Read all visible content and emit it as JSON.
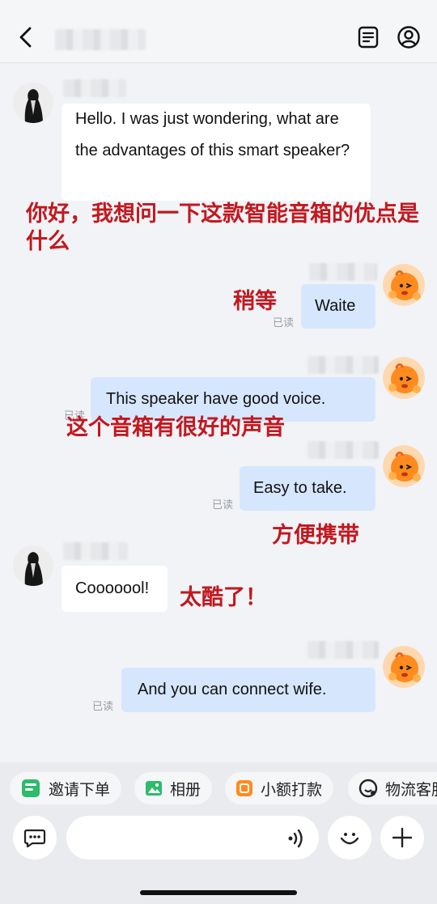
{
  "header": {
    "back_icon": "chevron-left-icon",
    "contact_name": "",
    "icons": [
      "notes-icon",
      "user-profile-icon"
    ]
  },
  "messages": [
    {
      "side": "in",
      "text": "Hello. I was just wondering, what are the advantages of this smart speaker?"
    },
    {
      "side": "out",
      "text": "Waite",
      "status": "已读"
    },
    {
      "side": "out",
      "text": "This speaker have good voice.",
      "status": "已读"
    },
    {
      "side": "out",
      "text": "Easy to take.",
      "status": "已读"
    },
    {
      "side": "in",
      "text": "Cooooool!"
    },
    {
      "side": "out",
      "text": "And you can connect wife.",
      "status": "已读"
    }
  ],
  "annotations": [
    "你好，我想问一下这款智能音箱的优点是什么",
    "稍等",
    "这个音箱有很好的声音",
    "方便携带",
    "太酷了！"
  ],
  "quick_actions": [
    {
      "label": "邀请下单",
      "icon": "order-invite-icon"
    },
    {
      "label": "相册",
      "icon": "photo-album-icon"
    },
    {
      "label": "小额打款",
      "icon": "small-payment-icon"
    },
    {
      "label": "物流客服",
      "icon": "logistics-service-icon"
    }
  ],
  "input_bar": {
    "placeholder": "",
    "icons": [
      "chat-mode-icon",
      "voice-icon",
      "emoji-icon",
      "plus-icon"
    ]
  },
  "colors": {
    "outgoing_bubble": "#D6E6FD",
    "incoming_bubble": "#FFFFFF",
    "annotation_red": "#C2181F",
    "background": "#F1F3F6"
  }
}
